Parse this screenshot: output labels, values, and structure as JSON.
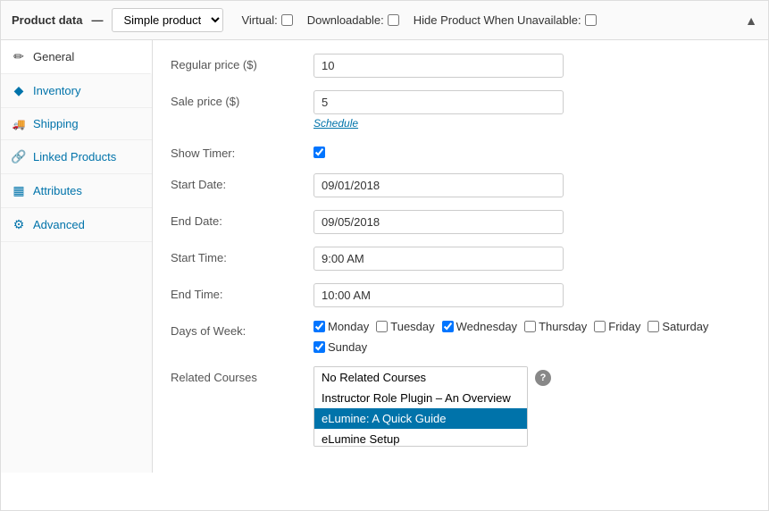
{
  "header": {
    "title": "Product data",
    "dash": "—",
    "product_type": "Simple product",
    "virtual_label": "Virtual:",
    "downloadable_label": "Downloadable:",
    "hide_product_label": "Hide Product When Unavailable:",
    "collapse_icon": "▲"
  },
  "sidebar": {
    "items": [
      {
        "id": "general",
        "label": "General",
        "icon": "✎",
        "active": true
      },
      {
        "id": "inventory",
        "label": "Inventory",
        "icon": "◈"
      },
      {
        "id": "shipping",
        "label": "Shipping",
        "icon": "🚚"
      },
      {
        "id": "linked-products",
        "label": "Linked Products",
        "icon": "🔗"
      },
      {
        "id": "attributes",
        "label": "Attributes",
        "icon": "▦"
      },
      {
        "id": "advanced",
        "label": "Advanced",
        "icon": "⚙"
      }
    ]
  },
  "form": {
    "regular_price_label": "Regular price ($)",
    "regular_price_value": "10",
    "sale_price_label": "Sale price ($)",
    "sale_price_value": "5",
    "schedule_link": "Schedule",
    "show_timer_label": "Show Timer:",
    "show_timer_checked": true,
    "start_date_label": "Start Date:",
    "start_date_value": "09/01/2018",
    "end_date_label": "End Date:",
    "end_date_value": "09/05/2018",
    "start_time_label": "Start Time:",
    "start_time_value": "9:00 AM",
    "end_time_label": "End Time:",
    "end_time_value": "10:00 AM",
    "days_of_week_label": "Days of Week:",
    "days": [
      {
        "id": "monday",
        "label": "Monday",
        "checked": true
      },
      {
        "id": "tuesday",
        "label": "Tuesday",
        "checked": false
      },
      {
        "id": "wednesday",
        "label": "Wednesday",
        "checked": true
      },
      {
        "id": "thursday",
        "label": "Thursday",
        "checked": false
      },
      {
        "id": "friday",
        "label": "Friday",
        "checked": false
      },
      {
        "id": "saturday",
        "label": "Saturday",
        "checked": false
      },
      {
        "id": "sunday",
        "label": "Sunday",
        "checked": true
      }
    ],
    "related_courses_label": "Related Courses",
    "related_courses_options": [
      {
        "value": "none",
        "label": "No Related Courses",
        "selected": false
      },
      {
        "value": "instructor",
        "label": "Instructor Role Plugin – An Overview",
        "selected": false
      },
      {
        "value": "elumine",
        "label": "eLumine: A Quick Guide",
        "selected": true
      },
      {
        "value": "elumine-setup",
        "label": "eLumine Setup",
        "selected": false
      }
    ]
  }
}
